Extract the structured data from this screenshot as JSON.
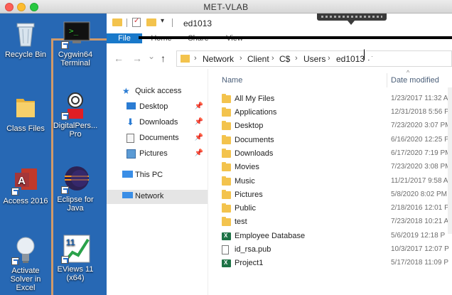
{
  "window": {
    "title": "MET-VLAB"
  },
  "desktop": {
    "icons": [
      {
        "label": "Recycle Bin",
        "icon": "recycle-bin-icon"
      },
      {
        "label": "Cygwin64 Terminal",
        "icon": "terminal-icon"
      },
      {
        "label": "Class Files",
        "icon": "folder-icon"
      },
      {
        "label": "DigitalPersona Pro",
        "icon": "fingerprint-icon"
      },
      {
        "label": "Access 2016",
        "icon": "access-icon"
      },
      {
        "label": "Eclipse for Java",
        "icon": "eclipse-icon"
      },
      {
        "label": "Activate Solver in Excel",
        "icon": "lightbulb-icon"
      },
      {
        "label": "EViews 11 (x64)",
        "icon": "eviews-icon"
      }
    ],
    "label_lines": {
      "cygwin": [
        "Cygwin64",
        "Terminal"
      ],
      "digital": [
        "DigitalPers...",
        "Pro"
      ],
      "eclipse": [
        "Eclipse for",
        "Java"
      ],
      "solver": [
        "Activate",
        "Solver in Excel"
      ],
      "eviews": [
        "EViews 11",
        "(x64)"
      ],
      "eviews_badge": "11"
    }
  },
  "explorer": {
    "title": "ed1013",
    "ribbon_tabs": [
      "File",
      "Home",
      "Share",
      "View"
    ],
    "address": {
      "crumbs": [
        "Network",
        "Client",
        "C$",
        "Users",
        "ed1013"
      ],
      "separator": "›"
    },
    "nav_buttons": {
      "back": "←",
      "forward": "→",
      "recent": "⌄",
      "up": "↑"
    },
    "nav_pane": {
      "items": [
        {
          "label": "Quick access",
          "icon": "star-icon",
          "pinned": false
        },
        {
          "label": "Desktop",
          "icon": "desktop-icon",
          "pinned": true
        },
        {
          "label": "Downloads",
          "icon": "download-icon",
          "pinned": true
        },
        {
          "label": "Documents",
          "icon": "documents-icon",
          "pinned": true
        },
        {
          "label": "Pictures",
          "icon": "pictures-icon",
          "pinned": true
        },
        {
          "label": "This PC",
          "icon": "pc-icon",
          "pinned": false
        },
        {
          "label": "Network",
          "icon": "network-icon",
          "pinned": false,
          "selected": true
        }
      ]
    },
    "columns": {
      "name": "Name",
      "date_modified": "Date modified",
      "sort_indicator": "^"
    },
    "files": [
      {
        "name": "All My Files",
        "date": "1/23/2017 11:32 A",
        "type": "folder"
      },
      {
        "name": "Applications",
        "date": "12/31/2018 5:56 P",
        "type": "folder"
      },
      {
        "name": "Desktop",
        "date": "7/23/2020 3:07 PM",
        "type": "folder"
      },
      {
        "name": "Documents",
        "date": "6/16/2020 12:25 P",
        "type": "folder"
      },
      {
        "name": "Downloads",
        "date": "6/17/2020 7:19 PM",
        "type": "folder"
      },
      {
        "name": "Movies",
        "date": "7/23/2020 3:08 PM",
        "type": "folder"
      },
      {
        "name": "Music",
        "date": "11/21/2017 9:58 A",
        "type": "folder"
      },
      {
        "name": "Pictures",
        "date": "5/8/2020 8:02 PM",
        "type": "folder"
      },
      {
        "name": "Public",
        "date": "2/18/2016 12:01 P",
        "type": "folder"
      },
      {
        "name": "test",
        "date": "7/23/2018 10:21 A",
        "type": "folder"
      },
      {
        "name": "Employee Database",
        "date": "5/6/2019 12:18 P",
        "type": "excel"
      },
      {
        "name": "id_rsa.pub",
        "date": "10/3/2017 12:07 P",
        "type": "file"
      },
      {
        "name": "Project1",
        "date": "5/17/2018 11:09 P",
        "type": "excel"
      }
    ]
  },
  "colors": {
    "desktop_bg": "#2768b4",
    "file_tab": "#1979ca",
    "folder": "#f3c34d",
    "excel": "#1d7245"
  }
}
